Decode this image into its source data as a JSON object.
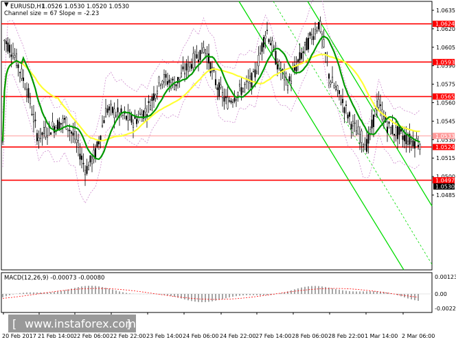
{
  "header": {
    "symbol": "EURUSD,H1",
    "ohlc": "1.0526 1.0530 1.0520 1.0530",
    "channel": "Channel size = 67 Slope = -2.23"
  },
  "price_axis": {
    "ticks": [
      "1.0635",
      "1.0620",
      "1.0605",
      "1.0590",
      "1.0575",
      "1.0560",
      "1.0545",
      "1.0530",
      "1.0515",
      "1.0500",
      "1.0485"
    ],
    "current_price": "1.0530"
  },
  "levels": [
    {
      "label": "1.0624",
      "color": "#ff0000",
      "kind": "fill"
    },
    {
      "label": "1.0593",
      "color": "#ff0000",
      "kind": "fill"
    },
    {
      "label": "1.0565",
      "color": "#ff0000",
      "kind": "fill"
    },
    {
      "label": "1.0533",
      "color": "#ff9999",
      "kind": "thin"
    },
    {
      "label": "1.0524",
      "color": "#ff0000",
      "kind": "fill"
    },
    {
      "label": "1.0497",
      "color": "#ff0000",
      "kind": "fill"
    }
  ],
  "time_axis": {
    "labels": [
      "20 Feb 2017",
      "21 Feb 14:00",
      "22 Feb 06:00",
      "22 Feb 22:00",
      "23 Feb 14:00",
      "24 Feb 06:00",
      "24 Feb 22:00",
      "27 Feb 14:00",
      "28 Feb 06:00",
      "28 Feb 22:00",
      "1 Mar 14:00",
      "2 Mar 06:00"
    ]
  },
  "macd": {
    "title": "MACD(12,26,9) -0.00073 -0.00080",
    "ticks": [
      "0.00123",
      "0.00",
      "-0.00221"
    ]
  },
  "watermark": {
    "text": "www.instaforex.com",
    "bracket_left": "[",
    "bracket_right": "]"
  },
  "colors": {
    "candles": "#000000",
    "ma_fast": "#009900",
    "ma_slow": "#ffff33",
    "channel": "#00dd00",
    "levels": "#ff0000",
    "envelope": "#cc88cc"
  }
}
